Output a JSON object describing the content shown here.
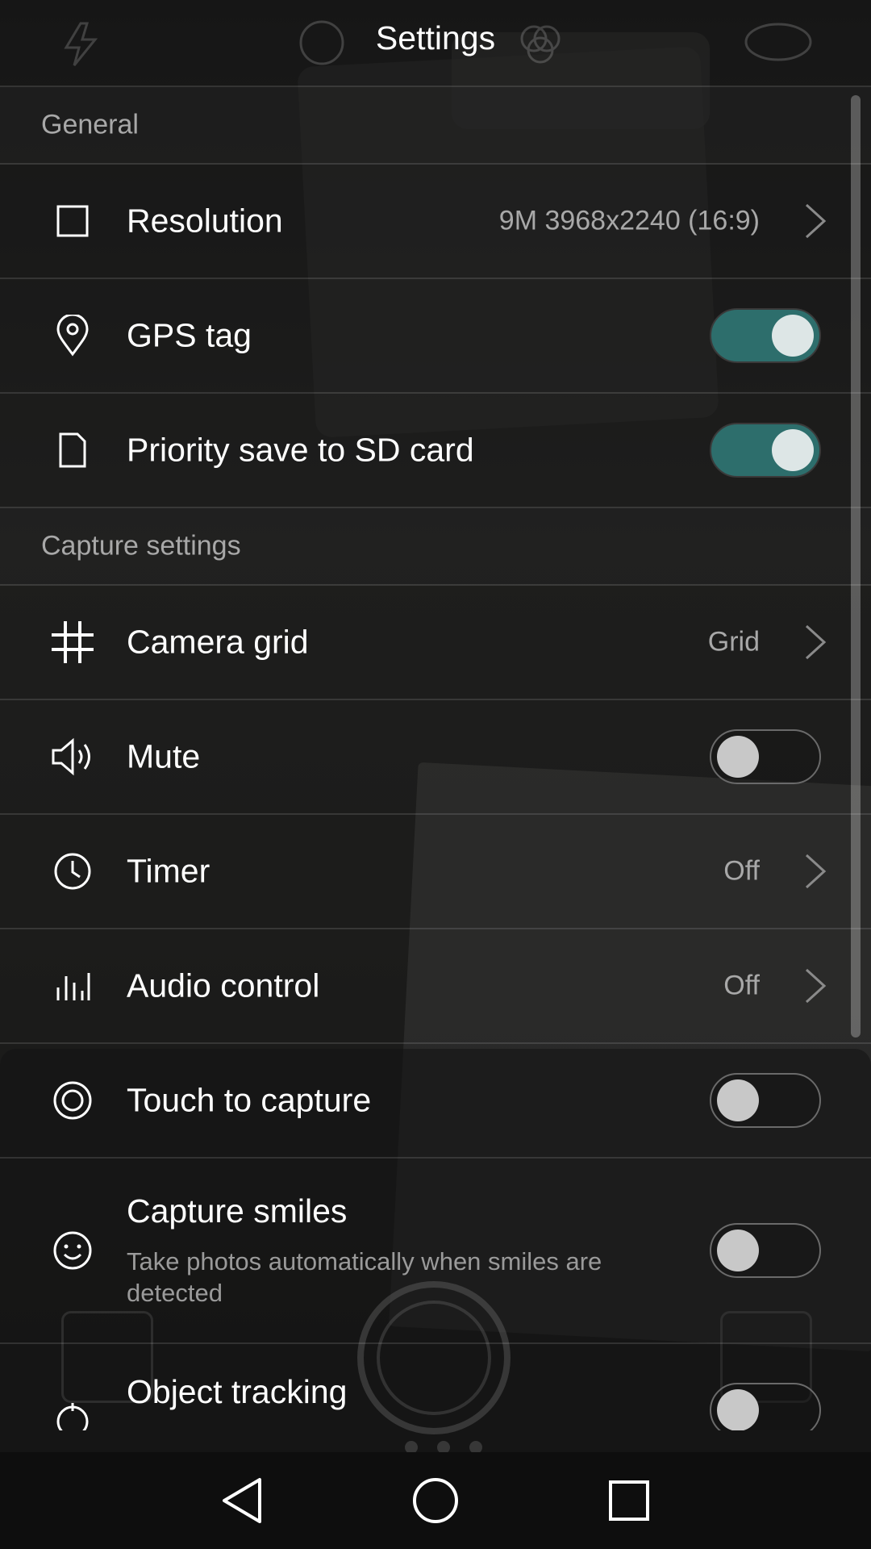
{
  "header": {
    "title": "Settings"
  },
  "sections": {
    "general": {
      "title": "General"
    },
    "capture": {
      "title": "Capture settings"
    }
  },
  "settings": {
    "resolution": {
      "label": "Resolution",
      "value": "9M 3968x2240 (16:9)",
      "icon": "resolution-square-icon"
    },
    "gps_tag": {
      "label": "GPS tag",
      "enabled": true,
      "icon": "location-pin-icon"
    },
    "priority_sd": {
      "label": "Priority save to SD card",
      "enabled": true,
      "icon": "sd-card-icon"
    },
    "camera_grid": {
      "label": "Camera grid",
      "value": "Grid",
      "icon": "grid-icon"
    },
    "mute": {
      "label": "Mute",
      "enabled": false,
      "icon": "speaker-icon"
    },
    "timer": {
      "label": "Timer",
      "value": "Off",
      "icon": "clock-icon"
    },
    "audio_control": {
      "label": "Audio control",
      "value": "Off",
      "icon": "audio-bars-icon"
    },
    "touch_capture": {
      "label": "Touch to capture",
      "enabled": false,
      "icon": "touch-circle-icon"
    },
    "capture_smiles": {
      "label": "Capture smiles",
      "description": "Take photos automatically when smiles are detected",
      "enabled": false,
      "icon": "smiley-icon"
    },
    "object_tracking": {
      "label": "Object tracking",
      "enabled": false,
      "icon": "tracking-icon"
    }
  },
  "colors": {
    "toggle_on": "#2d6e6c",
    "text_primary": "#ffffff",
    "text_secondary": "#a8a8a8"
  }
}
